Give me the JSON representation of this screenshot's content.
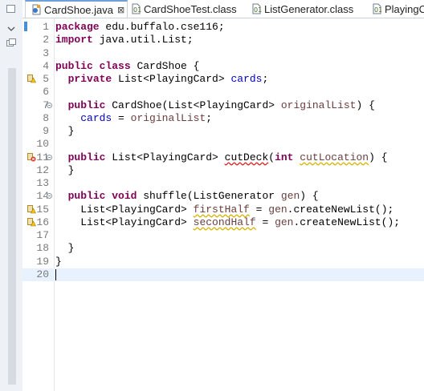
{
  "tabs": [
    {
      "label": "CardShoe.java",
      "active": true,
      "icon": "java-file-icon"
    },
    {
      "label": "CardShoeTest.class",
      "active": false,
      "icon": "class-file-icon"
    },
    {
      "label": "ListGenerator.class",
      "active": false,
      "icon": "class-file-icon"
    },
    {
      "label": "PlayingC",
      "active": false,
      "icon": "class-file-icon"
    }
  ],
  "colors": {
    "keyword": "#7f0055",
    "field": "#0000c0",
    "parameter": "#6a3e3e",
    "line_number": "#7a7a7a",
    "current_line": "#e8f2fe"
  },
  "editor": {
    "lines": [
      {
        "num": "1",
        "parts": [
          {
            "t": "package",
            "c": "kw"
          },
          {
            "t": " edu.buffalo.cse116;"
          }
        ]
      },
      {
        "num": "2",
        "parts": [
          {
            "t": "import",
            "c": "kw"
          },
          {
            "t": " java.util.List;"
          }
        ]
      },
      {
        "num": "3",
        "parts": []
      },
      {
        "num": "4",
        "parts": [
          {
            "t": "public",
            "c": "kw"
          },
          {
            "t": " "
          },
          {
            "t": "class",
            "c": "kw"
          },
          {
            "t": " CardShoe {"
          }
        ]
      },
      {
        "num": "5",
        "marker": "warning-marker-icon",
        "parts": [
          {
            "t": "  "
          },
          {
            "t": "private",
            "c": "kw"
          },
          {
            "t": " List<PlayingCard> "
          },
          {
            "t": "cards",
            "c": "field"
          },
          {
            "t": ";"
          }
        ]
      },
      {
        "num": "6",
        "parts": []
      },
      {
        "num": "7",
        "fold": true,
        "parts": [
          {
            "t": "  "
          },
          {
            "t": "public",
            "c": "kw"
          },
          {
            "t": " CardShoe(List<PlayingCard> "
          },
          {
            "t": "originalList",
            "c": "param"
          },
          {
            "t": ") {"
          }
        ]
      },
      {
        "num": "8",
        "parts": [
          {
            "t": "    "
          },
          {
            "t": "cards",
            "c": "field"
          },
          {
            "t": " = "
          },
          {
            "t": "originalList",
            "c": "param"
          },
          {
            "t": ";"
          }
        ]
      },
      {
        "num": "9",
        "parts": [
          {
            "t": "  }"
          }
        ]
      },
      {
        "num": "10",
        "parts": []
      },
      {
        "num": "11",
        "fold": true,
        "marker": "error-marker-icon",
        "parts": [
          {
            "t": "  "
          },
          {
            "t": "public",
            "c": "kw"
          },
          {
            "t": " List<PlayingCard> "
          },
          {
            "t": "cutDeck",
            "c": "err"
          },
          {
            "t": "("
          },
          {
            "t": "int",
            "c": "kw"
          },
          {
            "t": " "
          },
          {
            "t": "cutLocation",
            "c": "param warn"
          },
          {
            "t": ") {"
          }
        ]
      },
      {
        "num": "12",
        "parts": [
          {
            "t": "  }"
          }
        ]
      },
      {
        "num": "13",
        "parts": []
      },
      {
        "num": "14",
        "fold": true,
        "parts": [
          {
            "t": "  "
          },
          {
            "t": "public",
            "c": "kw"
          },
          {
            "t": " "
          },
          {
            "t": "void",
            "c": "kw"
          },
          {
            "t": " shuffle(ListGenerator "
          },
          {
            "t": "gen",
            "c": "param"
          },
          {
            "t": ") {"
          }
        ]
      },
      {
        "num": "15",
        "marker": "warning-marker-icon",
        "parts": [
          {
            "t": "    List<PlayingCard> "
          },
          {
            "t": "firstHalf",
            "c": "param warn"
          },
          {
            "t": " = "
          },
          {
            "t": "gen",
            "c": "param"
          },
          {
            "t": ".createNewList();"
          }
        ]
      },
      {
        "num": "16",
        "marker": "warning-marker-icon",
        "parts": [
          {
            "t": "    List<PlayingCard> "
          },
          {
            "t": "secondHalf",
            "c": "param warn"
          },
          {
            "t": " = "
          },
          {
            "t": "gen",
            "c": "param"
          },
          {
            "t": ".createNewList();"
          }
        ]
      },
      {
        "num": "17",
        "parts": []
      },
      {
        "num": "18",
        "parts": [
          {
            "t": "  }"
          }
        ]
      },
      {
        "num": "19",
        "parts": [
          {
            "t": "}"
          }
        ]
      },
      {
        "num": "20",
        "current": true,
        "caret": true,
        "parts": []
      }
    ]
  }
}
